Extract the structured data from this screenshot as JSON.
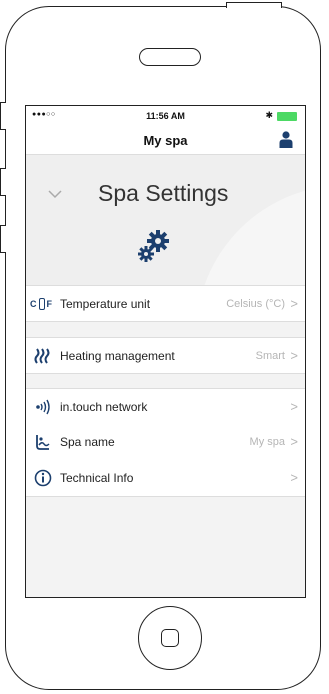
{
  "status": {
    "signal": "●●●○○ ",
    "time": "11:56 AM",
    "bluetooth": "✱"
  },
  "nav": {
    "title": "My spa"
  },
  "header": {
    "title": "Spa Settings"
  },
  "rows": [
    {
      "label": "Temperature unit",
      "value": "Celsius (°C)",
      "arrow": ">"
    },
    {
      "label": "Heating management",
      "value": "Smart",
      "arrow": ">"
    },
    {
      "label": "in.touch network",
      "value": "",
      "arrow": ">"
    },
    {
      "label": "Spa name",
      "value": "My spa",
      "arrow": ">"
    },
    {
      "label": "Technical Info",
      "value": "",
      "arrow": ">"
    }
  ],
  "icons": [
    "temperature-unit-icon",
    "heating-icon",
    "network-icon",
    "spa-name-icon",
    "info-icon",
    "gear-icon",
    "user-icon",
    "chevron-down-icon"
  ],
  "colors": {
    "accent": "#1c3f6e",
    "battery": "#4cd964",
    "muted": "#b5b5b5"
  }
}
